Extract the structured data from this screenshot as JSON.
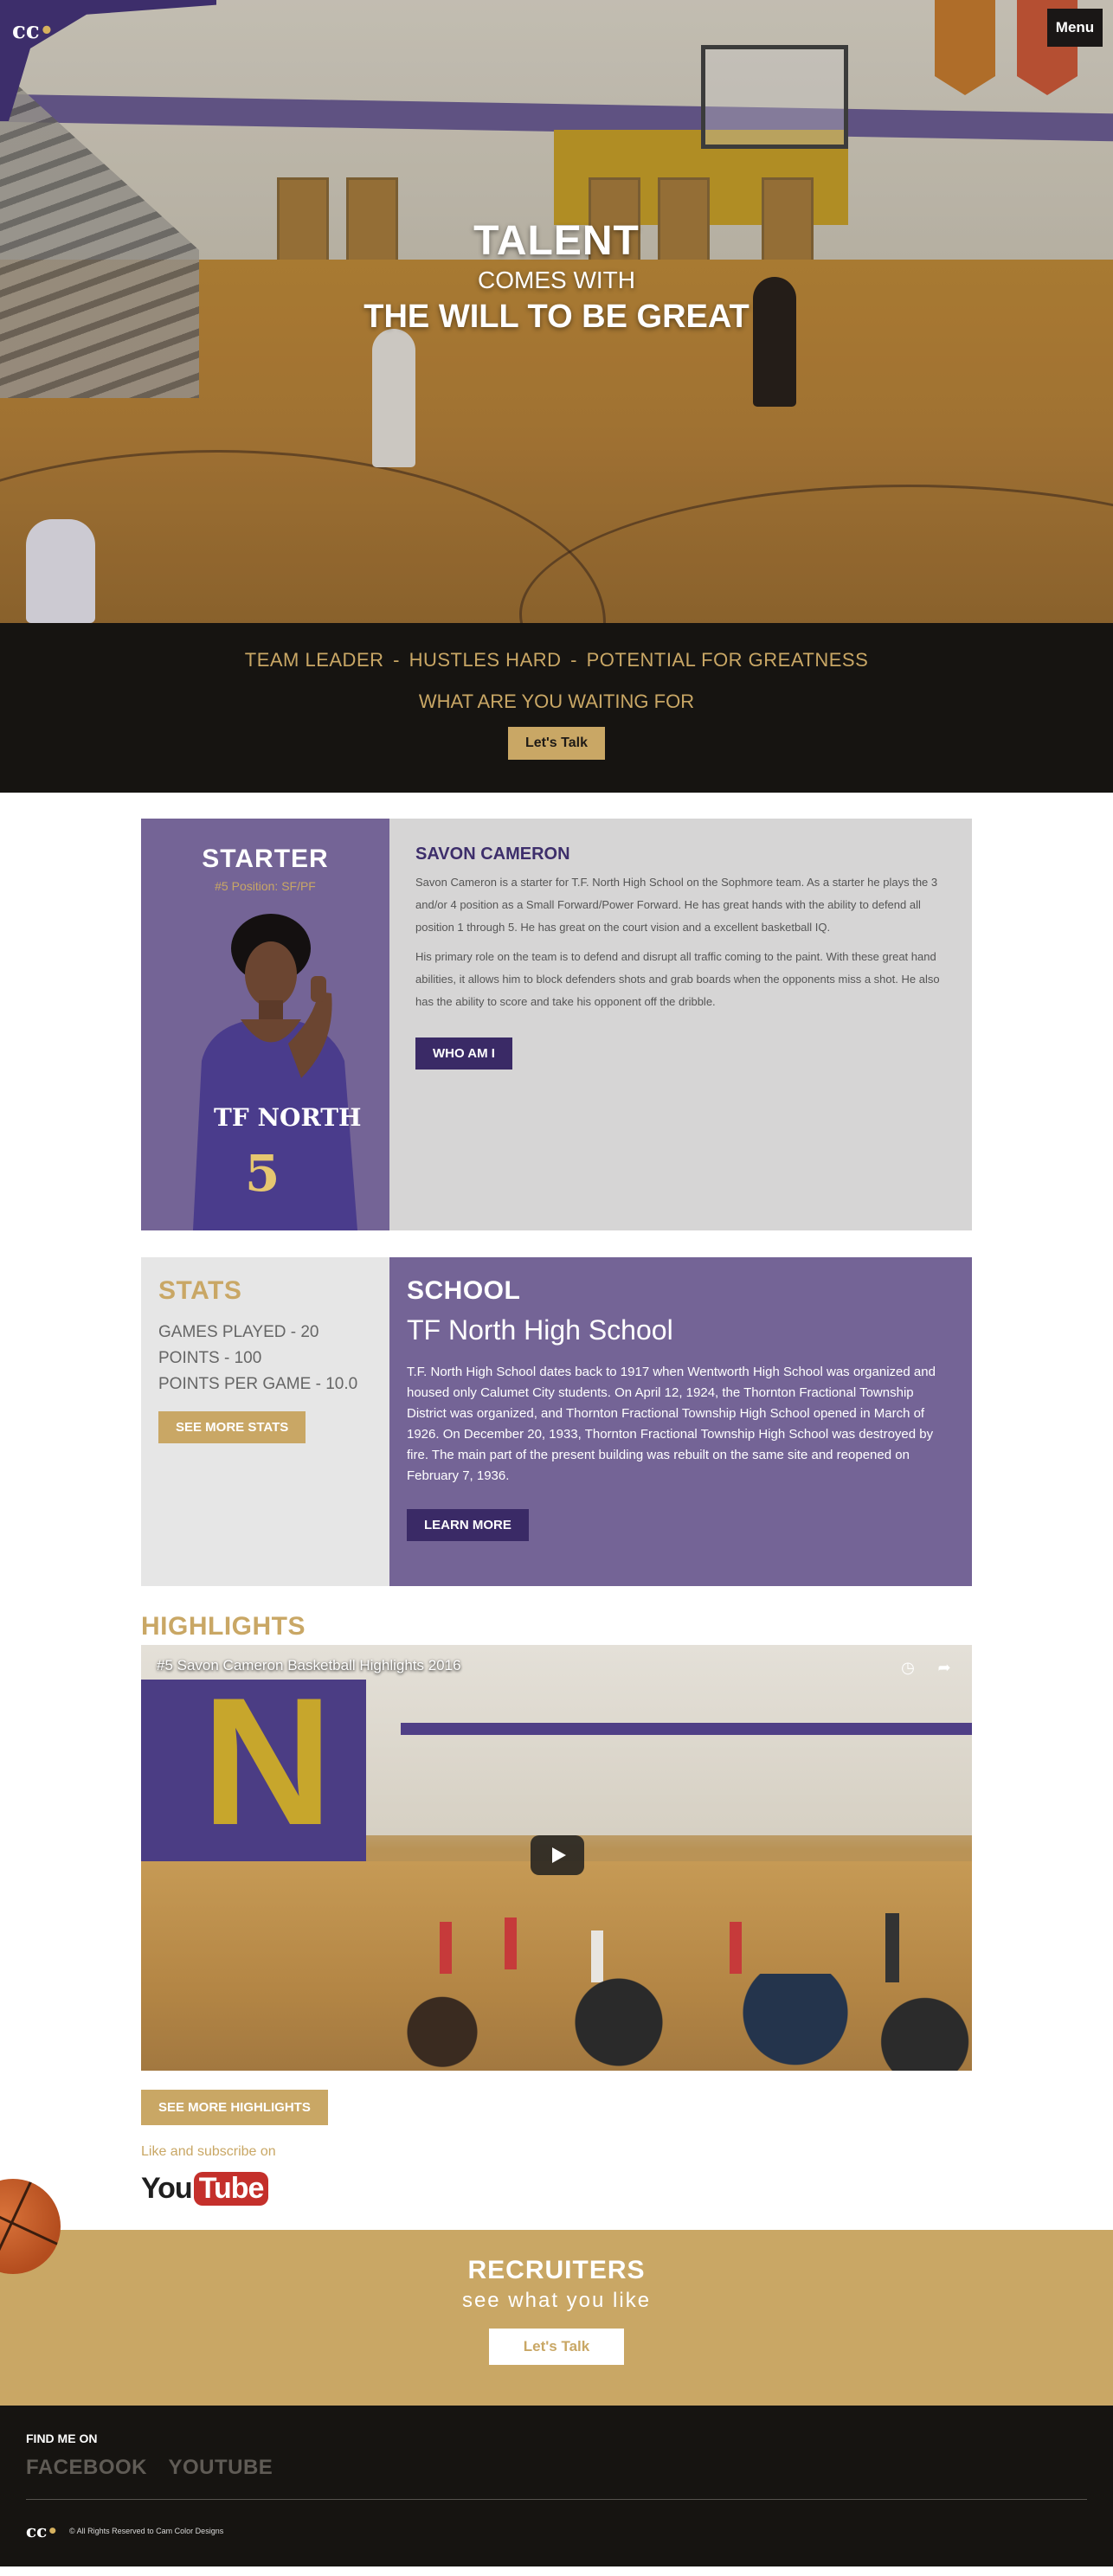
{
  "header": {
    "logo_text": "cc",
    "menu_label": "Menu"
  },
  "hero": {
    "line1": "TALENT",
    "line2": "COMES WITH",
    "line3": "THE WILL TO BE GREAT"
  },
  "tagline": {
    "items": [
      "TEAM LEADER",
      "HUSTLES HARD",
      "POTENTIAL FOR GREATNESS"
    ],
    "separator": "-",
    "question": "WHAT ARE YOU WAITING FOR",
    "cta_label": "Let's Talk"
  },
  "starter": {
    "title": "STARTER",
    "position": "#5 Position: SF/PF",
    "jersey_text": "TF NORTH",
    "jersey_number": "5",
    "name": "SAVON CAMERON",
    "para1": "Savon Cameron is a starter for T.F. North High School on the Sophmore team. As a starter he plays the 3 and/or 4 position as a Small Forward/Power Forward. He has great hands with the ability to defend all position 1 through 5. He has great on the court vision and a excellent basketball IQ.",
    "para2": "His primary role on the team is to defend and disrupt all traffic coming to the paint. With these great hand abilities, it allows him to block defenders shots and grab boards when the opponents miss a shot. He also has the ability to score and take his opponent off the dribble.",
    "button_label": "WHO AM I"
  },
  "stats": {
    "title": "STATS",
    "items": [
      "GAMES PLAYED - 20",
      "POINTS - 100",
      "POINTS PER GAME - 10.0"
    ],
    "button_label": "SEE MORE STATS"
  },
  "school": {
    "title": "SCHOOL",
    "name": "TF North High School",
    "description": "T.F. North High School dates back to 1917 when Wentworth High School was organized and housed only Calumet City students. On April 12, 1924, the Thornton Fractional Township District was organized, and Thornton Fractional Township High School opened in March of 1926. On December 20, 1933, Thornton Fractional Township High School was destroyed by fire. The main part of the present building was rebuilt on the same site and reopened on February 7, 1936.",
    "button_label": "LEARN MORE"
  },
  "highlights": {
    "title": "HIGHLIGHTS",
    "video_title": "#5 Savon Cameron Basketball Highlights 2016",
    "button_label": "SEE MORE HIGHLIGHTS",
    "subscribe_text": "Like and subscribe on",
    "youtube_you": "You",
    "youtube_tube": "Tube"
  },
  "recruiters": {
    "title": "RECRUITERS",
    "subtitle": "see what you like",
    "button_label": "Let's Talk"
  },
  "footer": {
    "find_label": "FIND ME ON",
    "links": [
      "FACEBOOK",
      "YOUTUBE"
    ],
    "logo_text": "cc",
    "copyright": "© All Rights Reserved to Cam Color Designs"
  },
  "colors": {
    "gold": "#c9a765",
    "purple": "#746496",
    "dark_purple": "#3a2a66",
    "black": "#161411"
  }
}
